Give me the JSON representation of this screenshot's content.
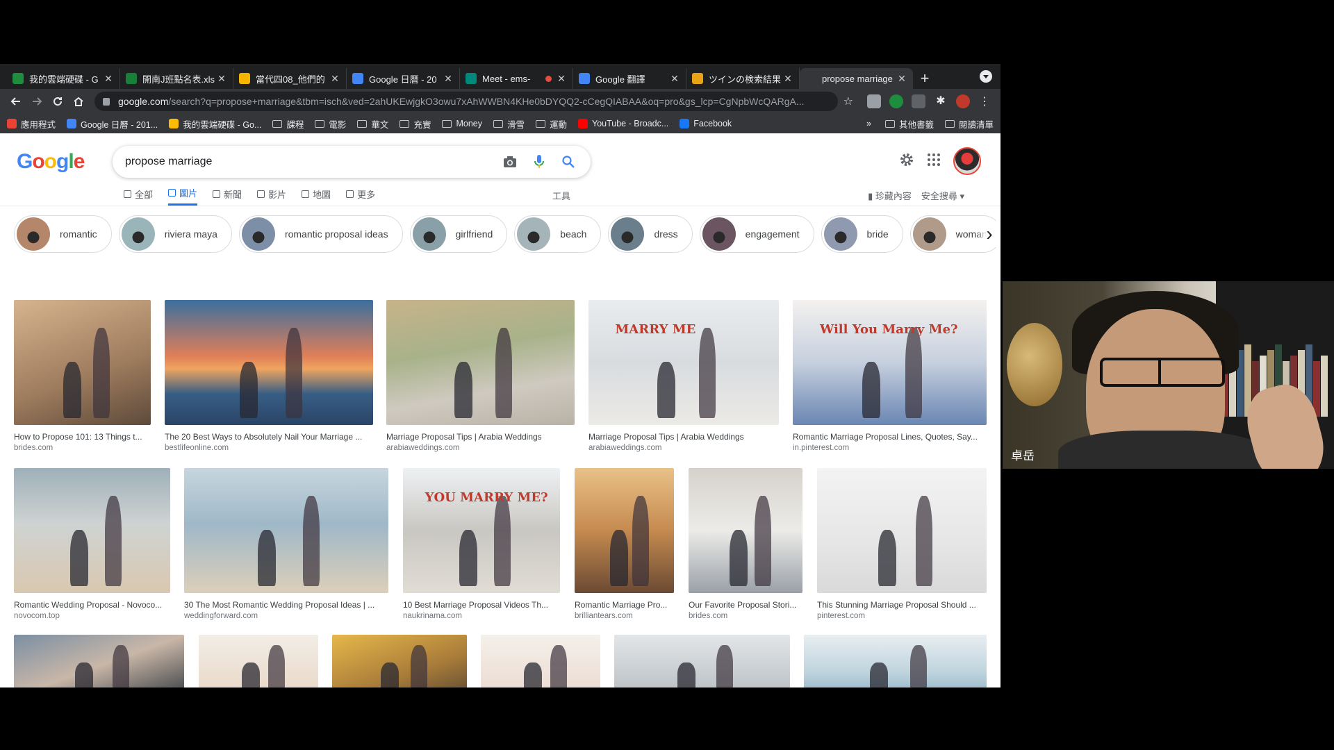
{
  "browser": {
    "tabs": [
      {
        "title": "我的雲端硬碟 - G",
        "favicon_color": "#1e8e3e"
      },
      {
        "title": "開南J班點名表.xls",
        "favicon_color": "#188038"
      },
      {
        "title": "當代四08_他們的",
        "favicon_color": "#f4b400"
      },
      {
        "title": "Google 日曆 - 20",
        "favicon_color": "#4285f4"
      },
      {
        "title": "Meet - ems-",
        "favicon_color": "#00897b",
        "recording": true
      },
      {
        "title": "Google 翻譯",
        "favicon_color": "#4285f4"
      },
      {
        "title": "ツインの検索結果",
        "favicon_color": "#e8a317"
      },
      {
        "title": "propose marriage",
        "favicon_color": "#35363a",
        "active": true
      }
    ],
    "new_tab": "+",
    "url_domain": "google.com",
    "url_rest": "/search?q=propose+marriage&tbm=isch&ved=2ahUKEwjgkO3owu7xAhWWBN4KHe0bDYQQ2-cCegQIABAA&oq=pro&gs_lcp=CgNpbWcQARgA...",
    "bookmarks": [
      {
        "label": "應用程式",
        "icon_color": "#ea4335"
      },
      {
        "label": "Google 日曆 - 201...",
        "icon_color": "#4285f4"
      },
      {
        "label": "我的雲端硬碟 - Go...",
        "icon_color": "#fbbc04"
      },
      {
        "label": "課程",
        "icon_color": ""
      },
      {
        "label": "電影",
        "icon_color": ""
      },
      {
        "label": "華文",
        "icon_color": ""
      },
      {
        "label": "充實",
        "icon_color": ""
      },
      {
        "label": "Money",
        "icon_color": ""
      },
      {
        "label": "滑雪",
        "icon_color": ""
      },
      {
        "label": "運動",
        "icon_color": ""
      },
      {
        "label": "YouTube - Broadc...",
        "icon_color": "#ff0000"
      },
      {
        "label": "Facebook",
        "icon_color": "#1877f2"
      }
    ],
    "bookmarks_overflow": "»",
    "other_bookmarks": "其他書籤",
    "reading_list": "閱讀清單"
  },
  "google": {
    "logo": "Google",
    "query": "propose marriage",
    "tabs": [
      {
        "label": "全部",
        "active": false
      },
      {
        "label": "圖片",
        "active": true
      },
      {
        "label": "新聞",
        "active": false
      },
      {
        "label": "影片",
        "active": false
      },
      {
        "label": "地圖",
        "active": false
      },
      {
        "label": "更多",
        "active": false
      }
    ],
    "tools": "工具",
    "saved": "珍藏內容",
    "safesearch": "安全搜尋 ▾",
    "chips": [
      {
        "label": "romantic",
        "color": "#b4876a"
      },
      {
        "label": "riviera maya",
        "color": "#9ab5b9"
      },
      {
        "label": "romantic proposal ideas",
        "color": "#7d8fa6"
      },
      {
        "label": "girlfriend",
        "color": "#8aa0a8"
      },
      {
        "label": "beach",
        "color": "#a4b4b8"
      },
      {
        "label": "dress",
        "color": "#6b7e8c"
      },
      {
        "label": "engagement",
        "color": "#6a5560"
      },
      {
        "label": "bride",
        "color": "#8f9ab0"
      },
      {
        "label": "woman",
        "color": "#b09a8a"
      }
    ],
    "results_row1": [
      {
        "caption": "How to Propose 101: 13 Things t...",
        "source": "brides.com",
        "bg": "linear-gradient(160deg,#d7b48f,#9c7a5c 60%,#5d4a3b)"
      },
      {
        "caption": "The 20 Best Ways to Absolutely Nail Your Marriage ...",
        "source": "bestlifeonline.com",
        "bg": "linear-gradient(180deg,#3b6f9e 0%,#e07f58 45%,#f0a560 55%,#385e85 75%,#2a4466)"
      },
      {
        "caption": "Marriage Proposal Tips | Arabia Weddings",
        "source": "arabiaweddings.com",
        "bg": "linear-gradient(170deg,#c7b38a,#a8b28a 40%,#cfcac0 70%,#b8b2a6)"
      },
      {
        "caption": "Marriage Proposal Tips | Arabia Weddings",
        "source": "arabiaweddings.com",
        "bg": "linear-gradient(180deg,#e9ecef,#d8dcdf 50%,#eceae6)",
        "overlay": "MARRY ME"
      },
      {
        "caption": "Romantic Marriage Proposal Lines, Quotes, Say...",
        "source": "in.pinterest.com",
        "bg": "linear-gradient(180deg,#f4f1ef,#c6d0de 50%,#6a86b3)",
        "overlay": "Will You Marry Me?"
      }
    ],
    "results_row2": [
      {
        "caption": "Romantic Wedding Proposal - Novoco...",
        "source": "novocom.top",
        "bg": "linear-gradient(180deg,#9fb0ba,#cfd3d2 45%,#d9c8b0)"
      },
      {
        "caption": "30 The Most Romantic Wedding Proposal Ideas | ...",
        "source": "weddingforward.com",
        "bg": "linear-gradient(180deg,#c7d6de,#9fb8c8 45%,#dccfb9)"
      },
      {
        "caption": "10 Best Marriage Proposal Videos Th...",
        "source": "naukrinama.com",
        "bg": "linear-gradient(180deg,#eef1f3,#c9c7c2 50%,#e1ddd5)",
        "overlay": "YOU  MARRY  ME?"
      },
      {
        "caption": "Romantic Marriage Pro...",
        "source": "brilliantears.com",
        "bg": "linear-gradient(180deg,#e9c188,#c58a4f 50%,#6b4a33)"
      },
      {
        "caption": "Our Favorite Proposal Stori...",
        "source": "brides.com",
        "bg": "linear-gradient(180deg,#d6d2cb,#ecebe8 50%,#9aa0a7)"
      },
      {
        "caption": "This Stunning Marriage Proposal Should ...",
        "source": "pinterest.com",
        "bg": "linear-gradient(180deg,#f3f3f3,#e6e6e6 60%,#d9d9d9)"
      }
    ],
    "results_row3": [
      {
        "bg": "linear-gradient(160deg,#7b8fa3,#c9b7a8 50%,#3b3f45)"
      },
      {
        "bg": "linear-gradient(180deg,#f2ede6,#e9d7c6)"
      },
      {
        "bg": "linear-gradient(160deg,#e6b84a,#a97c3a 60%,#5e4b33)"
      },
      {
        "bg": "linear-gradient(180deg,#f4f0ea,#ecdad0)"
      },
      {
        "bg": "linear-gradient(180deg,#e3e6e8,#b8bec3)"
      },
      {
        "bg": "linear-gradient(180deg,#e8eef1,#bfd4de 60%,#8fb2c5)"
      }
    ]
  },
  "webcam": {
    "participant_name": "卓岳"
  }
}
